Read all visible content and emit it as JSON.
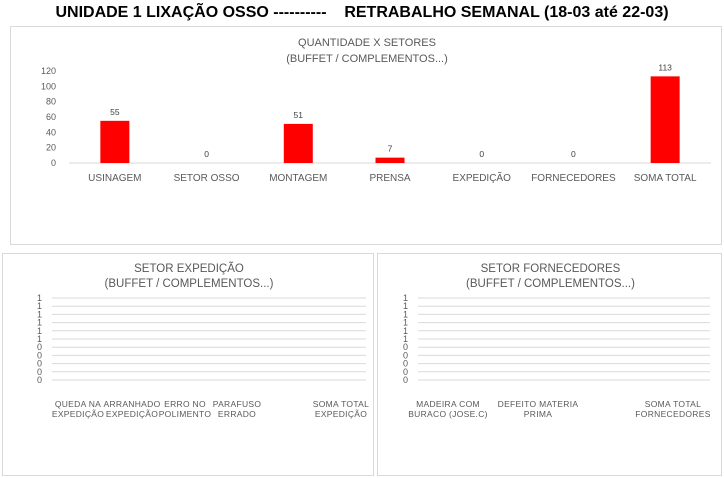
{
  "page": {
    "title": "UNIDADE 1 LIXAÇÃO OSSO ----------    RETRABALHO SEMANAL (18-03 até 22-03)"
  },
  "colors": {
    "bar": "#ff0000",
    "grid": "#d9d9d9",
    "text": "#595959",
    "border": "#d9d9d9"
  },
  "chart_data": [
    {
      "id": "quantidade-setores",
      "type": "bar",
      "title": "QUANTIDADE X SETORES",
      "subtitle": "(BUFFET / COMPLEMENTOS...)",
      "categories": [
        "USINAGEM",
        "SETOR OSSO",
        "MONTAGEM",
        "PRENSA",
        "EXPEDIÇÃO",
        "FORNECEDORES",
        "SOMA TOTAL"
      ],
      "values": [
        55,
        0,
        51,
        7,
        0,
        0,
        113
      ],
      "data_labels": [
        "55",
        "0",
        "51",
        "7",
        "0",
        "0",
        "113"
      ],
      "ylim": [
        0,
        120
      ],
      "yticks": [
        "0",
        "20",
        "40",
        "60",
        "80",
        "100",
        "120"
      ],
      "grid": false
    },
    {
      "id": "setor-expedicao",
      "type": "bar",
      "title": "SETOR EXPEDIÇÃO",
      "subtitle": "(BUFFET / COMPLEMENTOS...)",
      "categories": [
        [
          "QUEDA NA",
          "EXPEDIÇÃO"
        ],
        [
          "ARRANHADO",
          "EXPEDIÇÃO"
        ],
        [
          "ERRO NO",
          "POLIMENTO"
        ],
        [
          "PARAFUSO",
          "ERRADO"
        ],
        [
          "SOMA TOTAL",
          "EXPEDIÇÃO"
        ]
      ],
      "values": [
        0,
        0,
        0,
        0,
        0
      ],
      "yticks": [
        "0",
        "0",
        "0",
        "0",
        "0",
        "1",
        "1",
        "1",
        "1",
        "1",
        "1"
      ],
      "grid": true
    },
    {
      "id": "setor-fornecedores",
      "type": "bar",
      "title": "SETOR FORNECEDORES",
      "subtitle": "(BUFFET / COMPLEMENTOS...)",
      "categories": [
        [
          "MADEIRA COM",
          "BURACO (JOSE.C)"
        ],
        [
          "DEFEITO MATERIA",
          "PRIMA"
        ],
        [
          "SOMA TOTAL",
          "FORNECEDORES"
        ]
      ],
      "values": [
        0,
        0,
        0
      ],
      "yticks": [
        "0",
        "0",
        "0",
        "0",
        "0",
        "1",
        "1",
        "1",
        "1",
        "1",
        "1"
      ],
      "grid": true
    }
  ]
}
